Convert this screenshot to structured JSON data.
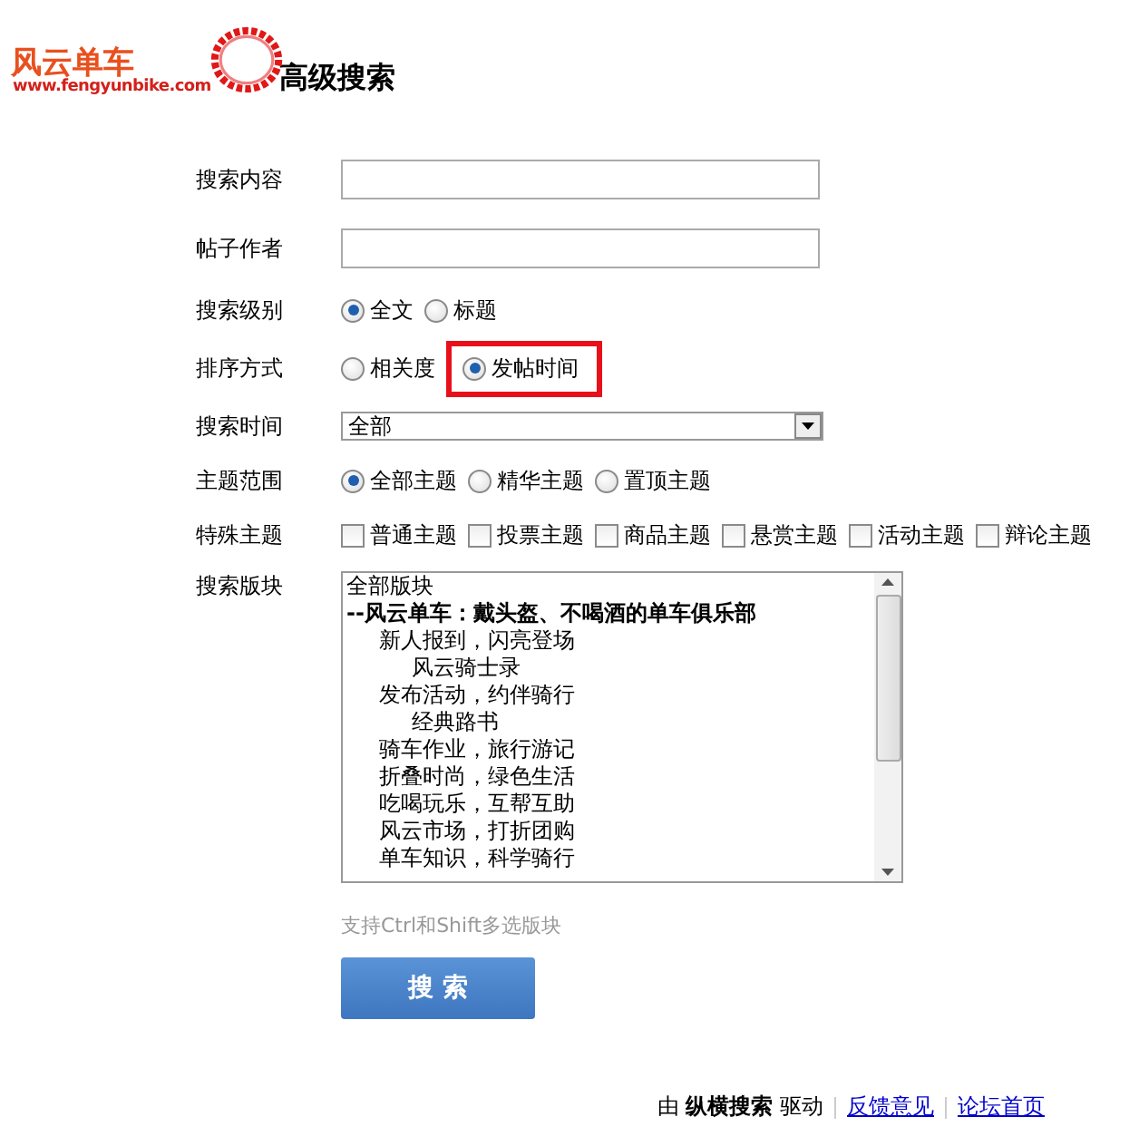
{
  "logo": {
    "name": "风云单车",
    "url": "www.fengyunbike.com"
  },
  "title": "高级搜索",
  "fields": [
    {
      "kind": "text",
      "label": "搜索内容"
    },
    {
      "kind": "text",
      "label": "帖子作者"
    },
    {
      "kind": "radio",
      "label": "搜索级别",
      "options": [
        {
          "label": "全文",
          "selected": true,
          "highlighted": false
        },
        {
          "label": "标题",
          "selected": false,
          "highlighted": false
        }
      ]
    },
    {
      "kind": "radio",
      "label": "排序方式",
      "options": [
        {
          "label": "相关度",
          "selected": false,
          "highlighted": false
        },
        {
          "label": "发帖时间",
          "selected": true,
          "highlighted": true
        }
      ]
    },
    {
      "kind": "select",
      "label": "搜索时间",
      "value": "全部"
    },
    {
      "kind": "radio",
      "label": "主题范围",
      "options": [
        {
          "label": "全部主题",
          "selected": true,
          "highlighted": false
        },
        {
          "label": "精华主题",
          "selected": false,
          "highlighted": false
        },
        {
          "label": "置顶主题",
          "selected": false,
          "highlighted": false
        }
      ]
    },
    {
      "kind": "checkbox",
      "label": "特殊主题",
      "options": [
        {
          "label": "普通主题",
          "checked": false
        },
        {
          "label": "投票主题",
          "checked": false
        },
        {
          "label": "商品主题",
          "checked": false
        },
        {
          "label": "悬赏主题",
          "checked": false
        },
        {
          "label": "活动主题",
          "checked": false
        },
        {
          "label": "辩论主题",
          "checked": false
        }
      ]
    },
    {
      "kind": "listbox",
      "label": "搜索版块",
      "items": [
        {
          "label": "全部版块",
          "bold": false
        },
        {
          "label": "--风云单车：戴头盔、不喝酒的单车俱乐部",
          "bold": true,
          "children": [
            {
              "label": "新人报到，闪亮登场",
              "bold": false,
              "children": [
                {
                  "label": "风云骑士录",
                  "bold": false
                }
              ]
            },
            {
              "label": "发布活动，约伴骑行",
              "bold": false,
              "children": [
                {
                  "label": "经典路书",
                  "bold": false
                }
              ]
            },
            {
              "label": "骑车作业，旅行游记",
              "bold": false
            },
            {
              "label": "折叠时尚，绿色生活",
              "bold": false
            },
            {
              "label": "吃喝玩乐，互帮互助",
              "bold": false
            },
            {
              "label": "风云市场，打折团购",
              "bold": false
            },
            {
              "label": "单车知识，科学骑行",
              "bold": false
            }
          ]
        }
      ],
      "hint": "支持Ctrl和Shift多选版块"
    }
  ],
  "submit": "搜 索",
  "footer": {
    "powered": "由 **纵横搜索** 驱动",
    "links": [
      "反馈意见",
      "论坛首页"
    ]
  }
}
